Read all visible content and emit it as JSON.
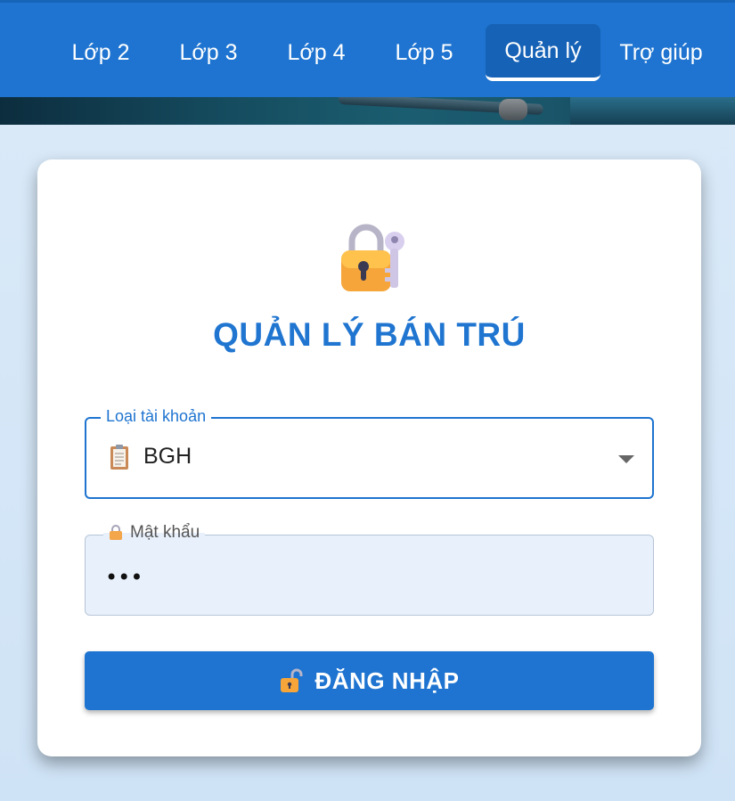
{
  "nav": {
    "items": [
      {
        "label": "Lớp 2",
        "active": false
      },
      {
        "label": "Lớp 3",
        "active": false
      },
      {
        "label": "Lớp 4",
        "active": false
      },
      {
        "label": "Lớp 5",
        "active": false
      },
      {
        "label": "Quản lý",
        "active": true
      },
      {
        "label": "Trợ giúp",
        "active": false
      }
    ]
  },
  "login": {
    "icon": "lock-with-key-icon",
    "title": "QUẢN LÝ BÁN TRÚ",
    "account_type": {
      "label": "Loại tài khoản",
      "icon": "clipboard-icon",
      "value": "BGH"
    },
    "password": {
      "label": "Mật khẩu",
      "icon": "lock-icon",
      "value": "•••"
    },
    "submit": {
      "icon": "unlock-icon",
      "label": "ĐĂNG NHẬP"
    }
  },
  "colors": {
    "primary": "#1e74d0",
    "active_tab": "#1662b6",
    "input_fill": "#e8f0fc"
  }
}
